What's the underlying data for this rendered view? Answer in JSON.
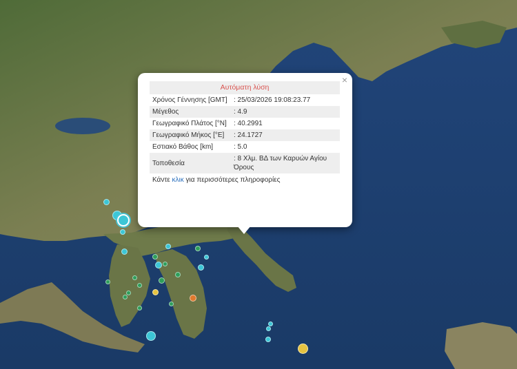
{
  "popup": {
    "title": "Αυτόματη λύση",
    "close_glyph": "×",
    "rows": [
      {
        "key": "Χρόνος Γέννησης [GMT]",
        "value": ": 25/03/2026 19:08:23.77"
      },
      {
        "key": "Μέγεθος",
        "value": ": 4.9"
      },
      {
        "key": "Γεωγραφικό Πλάτος [°N]",
        "value": ": 40.2991"
      },
      {
        "key": "Γεωγραφικό Μήκος [°E]",
        "value": ": 24.1727"
      },
      {
        "key": "Εστιακό Βάθος [km]",
        "value": ": 5.0"
      },
      {
        "key": "Τοποθεσία",
        "value": ": 8 Χλμ. ΒΔ των Καρυών Αγίου Όρους"
      }
    ],
    "footer_prefix": "Κάντε",
    "footer_link": "κλικ",
    "footer_suffix": "για περισσότερες πληροφορίες"
  },
  "colors": {
    "sea": "#1c3d6b",
    "land": "#6f7a4c",
    "marker_cyan": "#3cc6d6",
    "marker_green": "#2e9e5b",
    "marker_yellow": "#e6c341",
    "marker_orange": "#e07a2e",
    "popup_title": "#d9534f",
    "link": "#2a6fbd"
  }
}
